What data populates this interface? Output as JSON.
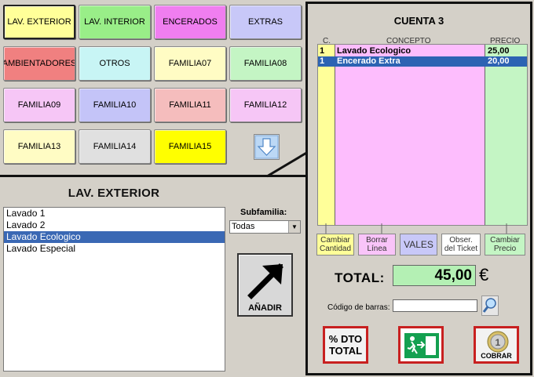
{
  "families": [
    {
      "label": "LAV. EXTERIOR",
      "color": "#ffff99",
      "selected": true
    },
    {
      "label": "LAV. INTERIOR",
      "color": "#99ee88",
      "selected": false
    },
    {
      "label": "ENCERADOS",
      "color": "#f07ef0",
      "selected": false
    },
    {
      "label": "EXTRAS",
      "color": "#c8c8f8",
      "selected": false
    },
    {
      "label": "AMBIENTADORES",
      "color": "#f08080",
      "selected": false
    },
    {
      "label": "OTROS",
      "color": "#c8f5f5",
      "selected": false
    },
    {
      "label": "FAMILIA07",
      "color": "#fffcc4",
      "selected": false
    },
    {
      "label": "FAMILIA08",
      "color": "#c4f5c4",
      "selected": false
    },
    {
      "label": "FAMILIA09",
      "color": "#f6c6f6",
      "selected": false
    },
    {
      "label": "FAMILIA10",
      "color": "#c4c4f8",
      "selected": false
    },
    {
      "label": "FAMILIA11",
      "color": "#f5bdbd",
      "selected": false
    },
    {
      "label": "FAMILIA12",
      "color": "#f6c6f6",
      "selected": false
    },
    {
      "label": "FAMILIA13",
      "color": "#fffcc4",
      "selected": false
    },
    {
      "label": "FAMILIA14",
      "color": "#e0e0e0",
      "selected": false
    },
    {
      "label": "FAMILIA15",
      "color": "#ffff00",
      "selected": false
    }
  ],
  "section_title": "LAV. EXTERIOR",
  "products": [
    {
      "label": "Lavado 1",
      "selected": false
    },
    {
      "label": "Lavado 2",
      "selected": false
    },
    {
      "label": "Lavado Ecologico",
      "selected": true
    },
    {
      "label": "Lavado Especial",
      "selected": false
    }
  ],
  "subfamilia": {
    "label": "Subfamilia:",
    "value": "Todas"
  },
  "add_button": {
    "label": "AÑADIR"
  },
  "account": {
    "title": "CUENTA 3",
    "headers": {
      "qty": "C.",
      "concept": "CONCEPTO",
      "price": "PRECIO"
    },
    "rows": [
      {
        "qty": "1",
        "concept": "Lavado Ecologico",
        "price": "25,00",
        "selected": false
      },
      {
        "qty": "1",
        "concept": "Encerado Extra",
        "price": "20,00",
        "selected": true
      }
    ]
  },
  "actions": {
    "change_qty": "Cambiar\nCantidad",
    "delete_line": "Borrar\nLínea",
    "vouchers": "VALES",
    "ticket_note": "Obser.\ndel Ticket",
    "change_price": "Cambiar\nPrecio"
  },
  "total": {
    "label": "TOTAL:",
    "value": "45,00",
    "currency": "€"
  },
  "barcode": {
    "label": "Código de barras:",
    "value": ""
  },
  "bottom_buttons": {
    "discount": "% DTO\nTOTAL",
    "cobrar": "COBRAR"
  },
  "colors": {
    "accent_blue": "#3a68b4",
    "red_border": "#c82020"
  }
}
